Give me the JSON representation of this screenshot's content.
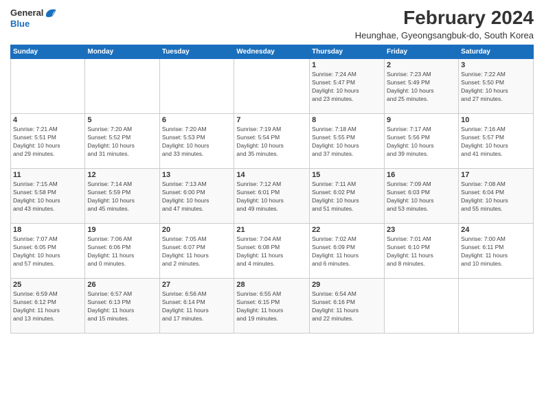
{
  "logo": {
    "general": "General",
    "blue": "Blue"
  },
  "header": {
    "month": "February 2024",
    "location": "Heunghae, Gyeongsangbuk-do, South Korea"
  },
  "days_of_week": [
    "Sunday",
    "Monday",
    "Tuesday",
    "Wednesday",
    "Thursday",
    "Friday",
    "Saturday"
  ],
  "weeks": [
    [
      {
        "day": "",
        "info": ""
      },
      {
        "day": "",
        "info": ""
      },
      {
        "day": "",
        "info": ""
      },
      {
        "day": "",
        "info": ""
      },
      {
        "day": "1",
        "info": "Sunrise: 7:24 AM\nSunset: 5:47 PM\nDaylight: 10 hours\nand 23 minutes."
      },
      {
        "day": "2",
        "info": "Sunrise: 7:23 AM\nSunset: 5:49 PM\nDaylight: 10 hours\nand 25 minutes."
      },
      {
        "day": "3",
        "info": "Sunrise: 7:22 AM\nSunset: 5:50 PM\nDaylight: 10 hours\nand 27 minutes."
      }
    ],
    [
      {
        "day": "4",
        "info": "Sunrise: 7:21 AM\nSunset: 5:51 PM\nDaylight: 10 hours\nand 29 minutes."
      },
      {
        "day": "5",
        "info": "Sunrise: 7:20 AM\nSunset: 5:52 PM\nDaylight: 10 hours\nand 31 minutes."
      },
      {
        "day": "6",
        "info": "Sunrise: 7:20 AM\nSunset: 5:53 PM\nDaylight: 10 hours\nand 33 minutes."
      },
      {
        "day": "7",
        "info": "Sunrise: 7:19 AM\nSunset: 5:54 PM\nDaylight: 10 hours\nand 35 minutes."
      },
      {
        "day": "8",
        "info": "Sunrise: 7:18 AM\nSunset: 5:55 PM\nDaylight: 10 hours\nand 37 minutes."
      },
      {
        "day": "9",
        "info": "Sunrise: 7:17 AM\nSunset: 5:56 PM\nDaylight: 10 hours\nand 39 minutes."
      },
      {
        "day": "10",
        "info": "Sunrise: 7:16 AM\nSunset: 5:57 PM\nDaylight: 10 hours\nand 41 minutes."
      }
    ],
    [
      {
        "day": "11",
        "info": "Sunrise: 7:15 AM\nSunset: 5:58 PM\nDaylight: 10 hours\nand 43 minutes."
      },
      {
        "day": "12",
        "info": "Sunrise: 7:14 AM\nSunset: 5:59 PM\nDaylight: 10 hours\nand 45 minutes."
      },
      {
        "day": "13",
        "info": "Sunrise: 7:13 AM\nSunset: 6:00 PM\nDaylight: 10 hours\nand 47 minutes."
      },
      {
        "day": "14",
        "info": "Sunrise: 7:12 AM\nSunset: 6:01 PM\nDaylight: 10 hours\nand 49 minutes."
      },
      {
        "day": "15",
        "info": "Sunrise: 7:11 AM\nSunset: 6:02 PM\nDaylight: 10 hours\nand 51 minutes."
      },
      {
        "day": "16",
        "info": "Sunrise: 7:09 AM\nSunset: 6:03 PM\nDaylight: 10 hours\nand 53 minutes."
      },
      {
        "day": "17",
        "info": "Sunrise: 7:08 AM\nSunset: 6:04 PM\nDaylight: 10 hours\nand 55 minutes."
      }
    ],
    [
      {
        "day": "18",
        "info": "Sunrise: 7:07 AM\nSunset: 6:05 PM\nDaylight: 10 hours\nand 57 minutes."
      },
      {
        "day": "19",
        "info": "Sunrise: 7:06 AM\nSunset: 6:06 PM\nDaylight: 11 hours\nand 0 minutes."
      },
      {
        "day": "20",
        "info": "Sunrise: 7:05 AM\nSunset: 6:07 PM\nDaylight: 11 hours\nand 2 minutes."
      },
      {
        "day": "21",
        "info": "Sunrise: 7:04 AM\nSunset: 6:08 PM\nDaylight: 11 hours\nand 4 minutes."
      },
      {
        "day": "22",
        "info": "Sunrise: 7:02 AM\nSunset: 6:09 PM\nDaylight: 11 hours\nand 6 minutes."
      },
      {
        "day": "23",
        "info": "Sunrise: 7:01 AM\nSunset: 6:10 PM\nDaylight: 11 hours\nand 8 minutes."
      },
      {
        "day": "24",
        "info": "Sunrise: 7:00 AM\nSunset: 6:11 PM\nDaylight: 11 hours\nand 10 minutes."
      }
    ],
    [
      {
        "day": "25",
        "info": "Sunrise: 6:59 AM\nSunset: 6:12 PM\nDaylight: 11 hours\nand 13 minutes."
      },
      {
        "day": "26",
        "info": "Sunrise: 6:57 AM\nSunset: 6:13 PM\nDaylight: 11 hours\nand 15 minutes."
      },
      {
        "day": "27",
        "info": "Sunrise: 6:56 AM\nSunset: 6:14 PM\nDaylight: 11 hours\nand 17 minutes."
      },
      {
        "day": "28",
        "info": "Sunrise: 6:55 AM\nSunset: 6:15 PM\nDaylight: 11 hours\nand 19 minutes."
      },
      {
        "day": "29",
        "info": "Sunrise: 6:54 AM\nSunset: 6:16 PM\nDaylight: 11 hours\nand 22 minutes."
      },
      {
        "day": "",
        "info": ""
      },
      {
        "day": "",
        "info": ""
      }
    ]
  ]
}
